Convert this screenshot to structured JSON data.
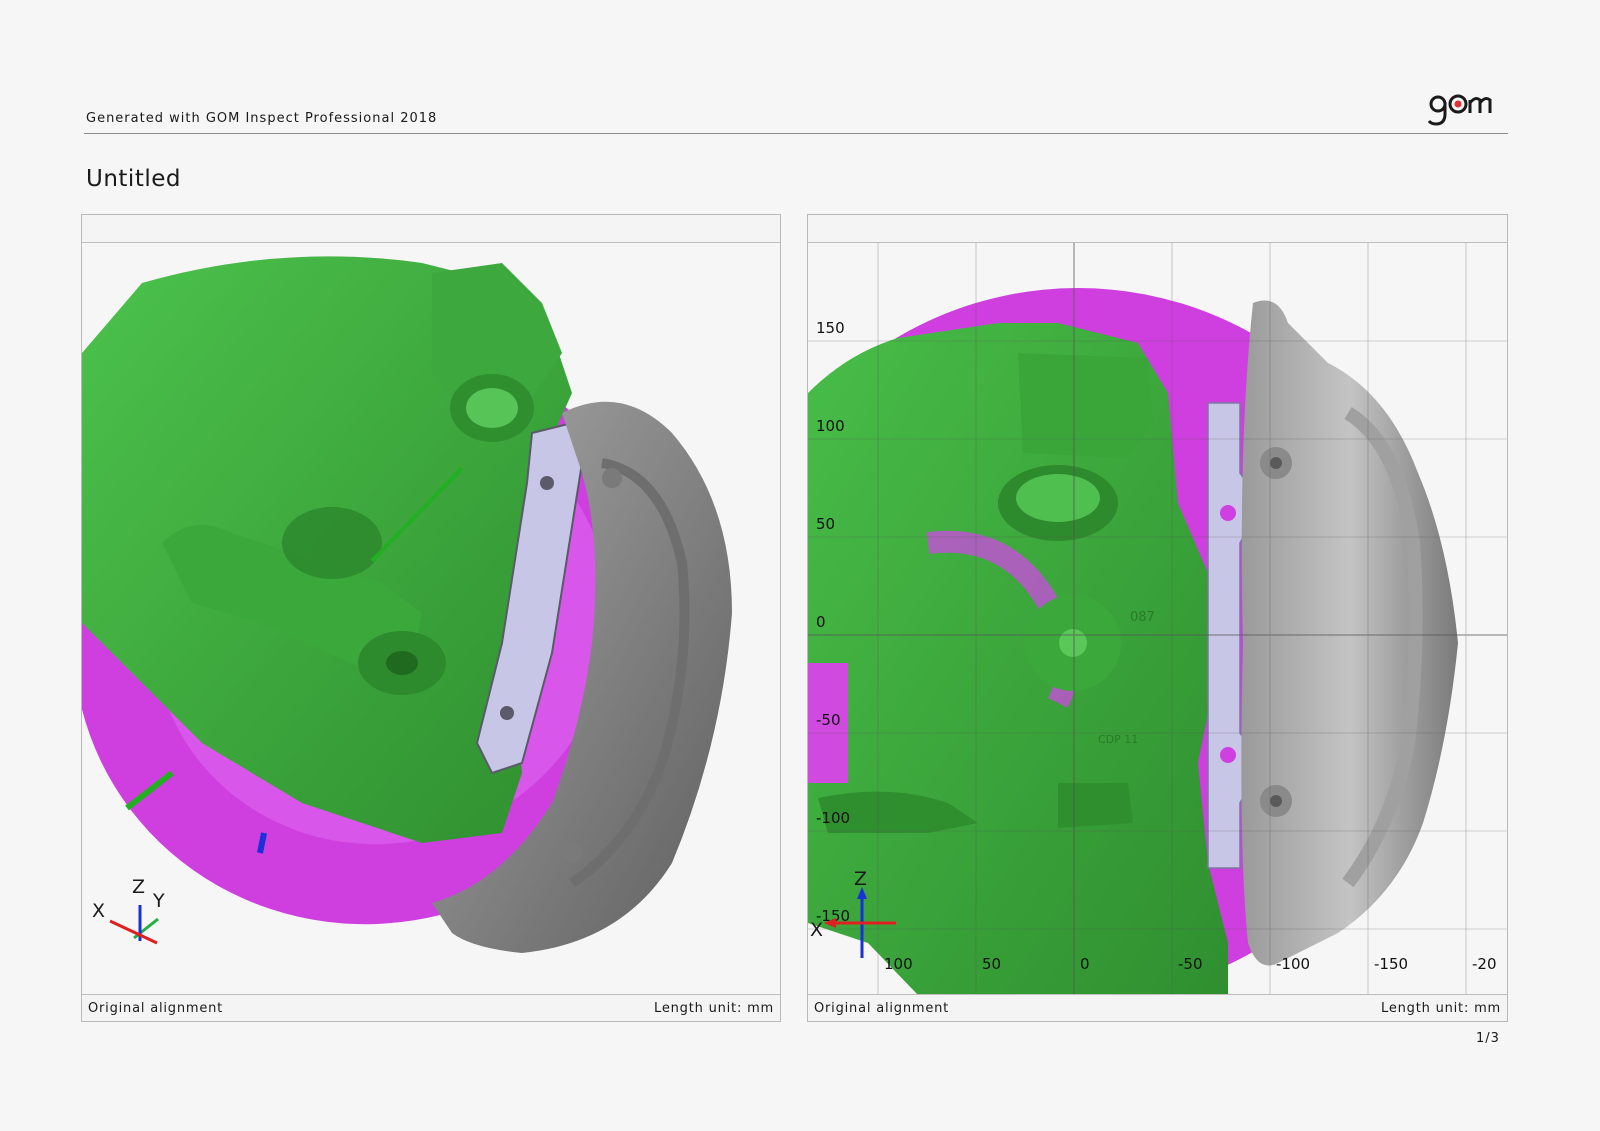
{
  "header": {
    "generator": "Generated with GOM Inspect Professional 2018",
    "logo_text": "gom"
  },
  "page_title": "Untitled",
  "colors": {
    "fixture_green": "#3fae3f",
    "disc_magenta": "#d23be2",
    "caliper_gray": "#8e8e8e",
    "bracket_lavender": "#c8c6e6",
    "axis_x": "#e02020",
    "axis_y": "#20b040",
    "axis_z": "#1a30d8",
    "logo_accent": "#e23030"
  },
  "left_panel": {
    "footer_left": "Original alignment",
    "footer_right": "Length unit: mm",
    "axis_labels": {
      "x": "X",
      "z": "Z",
      "y": "Y"
    }
  },
  "right_panel": {
    "footer_left": "Original alignment",
    "footer_right": "Length unit: mm",
    "axis_labels": {
      "x": "X",
      "z": "Z"
    },
    "y_ticks": [
      "150",
      "100",
      "50",
      "0",
      "-50",
      "-100",
      "-150"
    ],
    "x_ticks": [
      "100",
      "50",
      "0",
      "-50",
      "-100",
      "-150",
      "-20"
    ],
    "part_markings": [
      "087",
      "CDP 11"
    ]
  },
  "page_number": "1/3"
}
